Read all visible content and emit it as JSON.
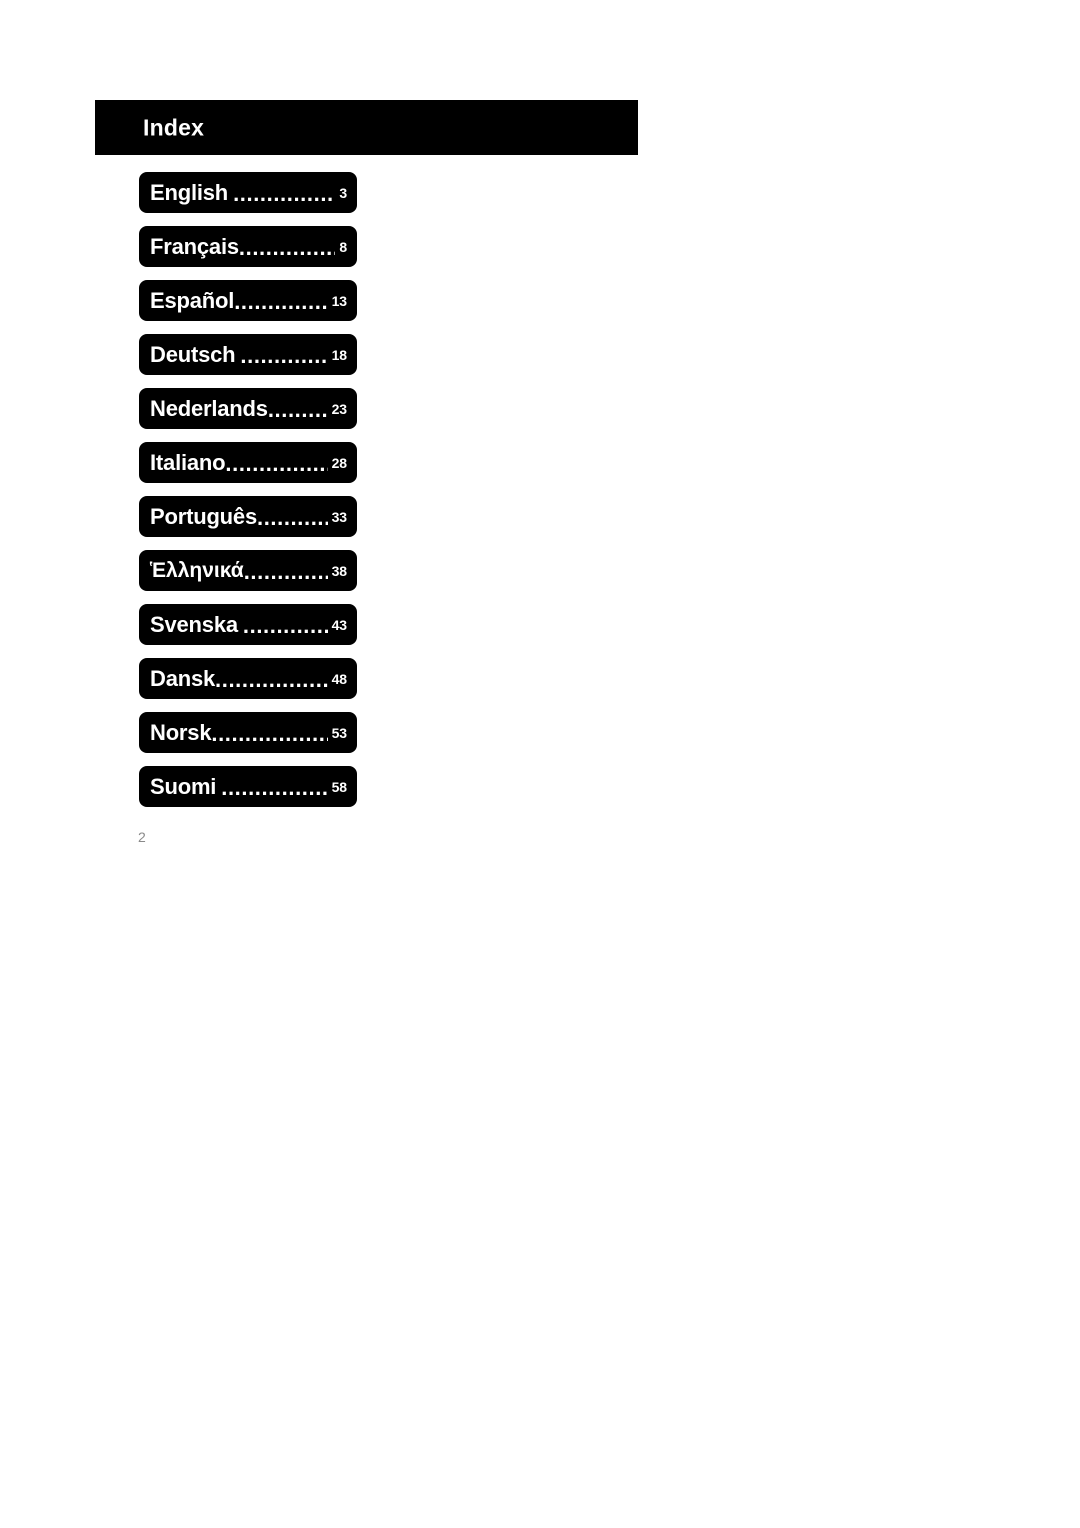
{
  "document": {
    "folio": "2",
    "background_color": "#ffffff",
    "accent_color": "#000000",
    "text_on_accent_color": "#ffffff",
    "folio_color": "#8a8a8a"
  },
  "header": {
    "title": "Index"
  },
  "index": {
    "leader_dots": "................................................",
    "items": [
      {
        "label": "English",
        "page": "3",
        "spacing_before_leader": true
      },
      {
        "label": "Français",
        "page": "8",
        "spacing_before_leader": false
      },
      {
        "label": "Español",
        "page": "13",
        "spacing_before_leader": false
      },
      {
        "label": "Deutsch",
        "page": "18",
        "spacing_before_leader": true
      },
      {
        "label": "Nederlands",
        "page": "23",
        "spacing_before_leader": false
      },
      {
        "label": "Italiano",
        "page": "28",
        "spacing_before_leader": false
      },
      {
        "label": "Português",
        "page": "33",
        "spacing_before_leader": false
      },
      {
        "label": "Ἑλληνικά",
        "page": "38",
        "spacing_before_leader": false
      },
      {
        "label": "Svenska",
        "page": "43",
        "spacing_before_leader": true
      },
      {
        "label": "Dansk",
        "page": "48",
        "spacing_before_leader": false
      },
      {
        "label": "Norsk",
        "page": "53",
        "spacing_before_leader": false
      },
      {
        "label": "Suomi",
        "page": "58",
        "spacing_before_leader": true
      }
    ]
  }
}
